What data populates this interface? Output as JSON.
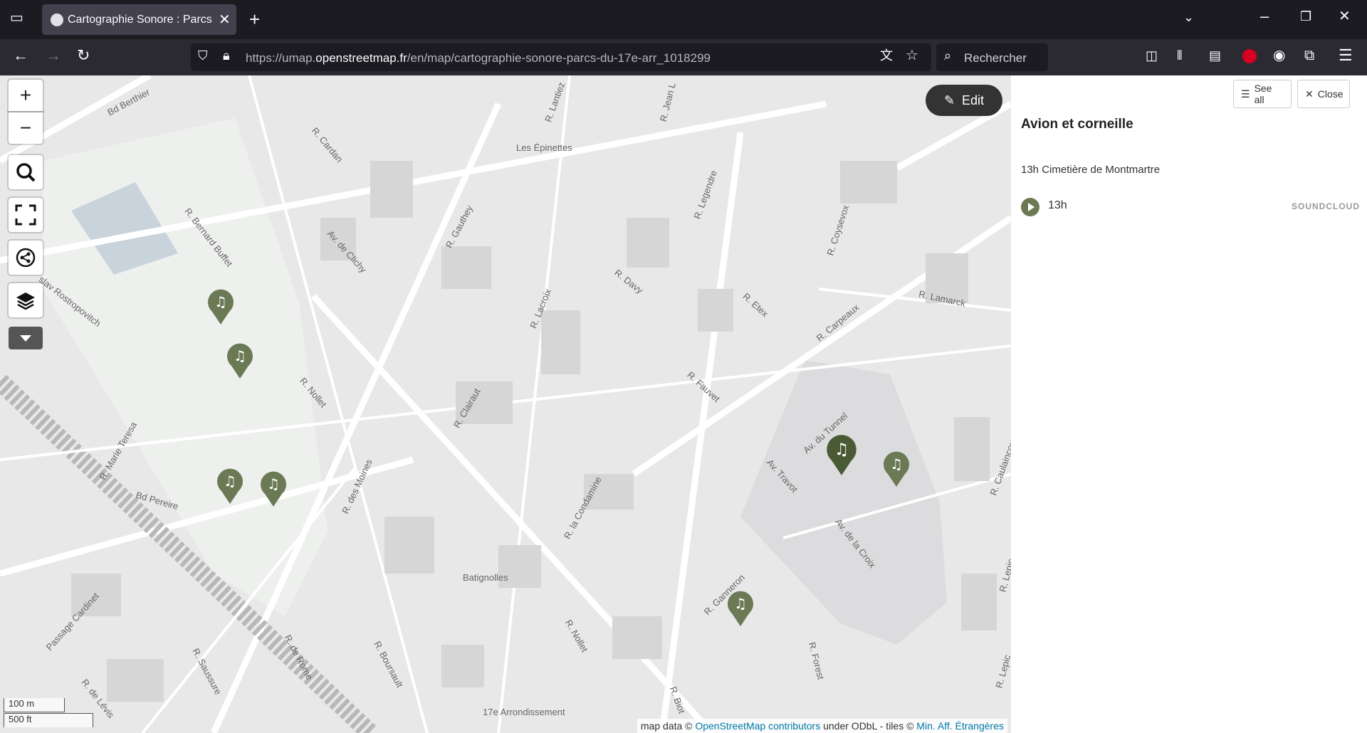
{
  "browser": {
    "tab_title": "Cartographie Sonore : Parcs du",
    "url_prefix": "https://umap.",
    "url_domain": "openstreetmap.fr",
    "url_path": "/en/map/cartographie-sonore-parcs-du-17e-arr_1018299",
    "search_placeholder": "Rechercher"
  },
  "map": {
    "edit_label": "Edit",
    "zoom_in": "+",
    "zoom_out": "−",
    "scale_metric": "100 m",
    "scale_imperial": "500 ft",
    "attribution_prefix": "map data © ",
    "attribution_osm": "OpenStreetMap contributors",
    "attribution_mid": " under ODbL - tiles © ",
    "attribution_tiles": "Min. Aff. Étrangères",
    "labels": {
      "bd_berthier": "Bd Berthier",
      "r_cardan": "R. Cardan",
      "les_epinettes": "Les Épinettes",
      "r_gauthey": "R. Gauthey",
      "av_clichy": "Av. de Clichy",
      "r_legendre": "R. Legendre",
      "r_lamarck": "R. Lamarck",
      "r_bernard_buffet": "R. Bernard Buffet",
      "r_davy": "R. Davy",
      "r_lacroix": "R. Lacroix",
      "r_etex": "R. Etex",
      "r_carpeaux": "R. Carpeaux",
      "r_nollet": "R. Nollet",
      "r_clairaut": "R. Clairaut",
      "r_fauvet": "R. Fauvet",
      "av_tunnel": "Av. du Tunnel",
      "av_travot": "Av. Travot",
      "av_croix": "Av. de la Croix",
      "bd_pereire": "Bd Pereire",
      "r_des_moines": "R. des Moines",
      "r_la_condamine": "R. la Condamine",
      "r_ganneron": "R. Ganneron",
      "batignolles": "Batignolles",
      "passage_cardinet": "Passage Cardinet",
      "r_de_rome": "R. de Rome",
      "r_boursault": "R. Boursault",
      "r_forest": "R. Forest",
      "r_saussure": "R. Saussure",
      "r_de_levis": "R. de Lévis",
      "arrondissement": "17e Arrondissement",
      "r_biot": "R. Biot",
      "r_caulaincourt": "R. Caulaincourt",
      "r_lepic": "R. Lepic",
      "r_coysevox": "R. Coysevox",
      "r_marie_teresa": "R. Marie Teresa",
      "slav_rostropovitch": "slav Rostropovitch",
      "r_lantiez": "R. Lantiez",
      "r_jean_leclaire": "R. Jean L"
    }
  },
  "panel": {
    "see_all": "See all",
    "close": "Close",
    "title": "Avion et corneille",
    "subtitle": "13h Cimetière de Montmartre",
    "track_label": "13h",
    "soundcloud": "SOUNDCLOUD"
  },
  "colors": {
    "marker": "#6b7a55",
    "marker_selected": "#4a5a35",
    "link": "#0078a8"
  }
}
